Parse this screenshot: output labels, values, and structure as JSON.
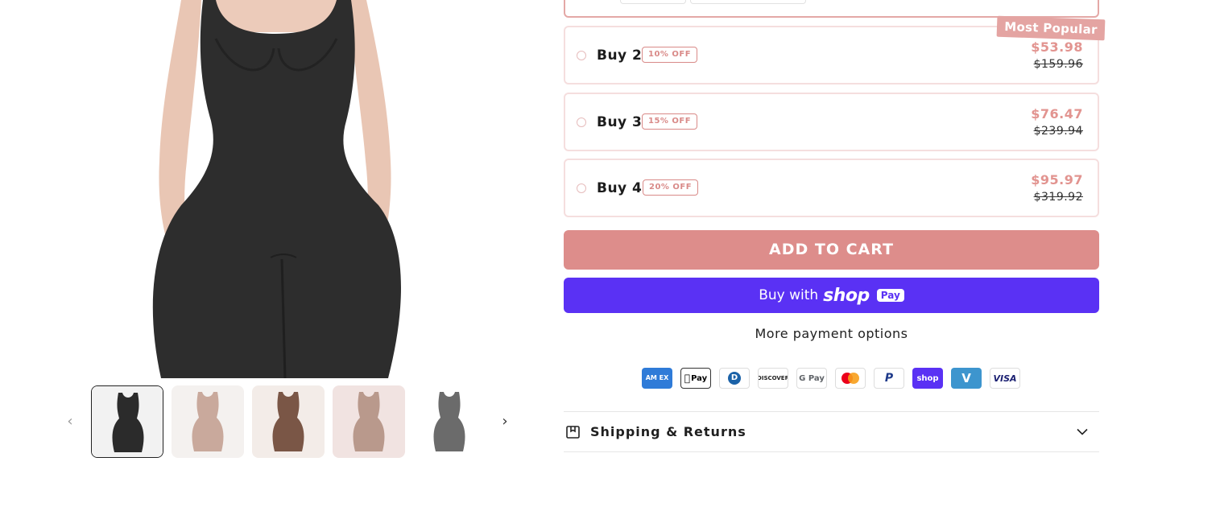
{
  "gallery": {
    "main_image_alt": "Black seamless bodysuit shapewear",
    "prev_icon": "chevron-left-icon",
    "next_icon": "chevron-right-icon",
    "thumbnails": [
      {
        "color": "#2b2b2b",
        "bg": "#f2f2f2",
        "active": true
      },
      {
        "color": "#c9a99c",
        "bg": "#f4f1ef",
        "active": false
      },
      {
        "color": "#7a5646",
        "bg": "#f3ece8",
        "active": false
      },
      {
        "color": "#b9998c",
        "bg": "#f1e3e1",
        "active": false
      },
      {
        "color": "#6b6b6b",
        "bg": "#ffffff",
        "active": false
      }
    ]
  },
  "bundle": {
    "ribbon": "Most Popular",
    "options": [
      {
        "name": "Buy 2",
        "badge": "10% OFF",
        "price": "$53.98",
        "compare": "$159.96"
      },
      {
        "name": "Buy 3",
        "badge": "15% OFF",
        "price": "$76.47",
        "compare": "$239.94"
      },
      {
        "name": "Buy 4",
        "badge": "20% OFF",
        "price": "$95.97",
        "compare": "$319.92"
      }
    ]
  },
  "actions": {
    "add_to_cart": "ADD TO CART",
    "buy_with": "Buy with",
    "shop_pay_logo": "shop",
    "shop_pay_pill": "Pay",
    "more_options": "More payment options"
  },
  "payment_methods": [
    {
      "name": "american-express-icon",
      "label": "AM EX"
    },
    {
      "name": "apple-pay-icon",
      "label": "Pay"
    },
    {
      "name": "diners-club-icon",
      "label": "D"
    },
    {
      "name": "discover-icon",
      "label": "DISCOVER"
    },
    {
      "name": "google-pay-icon",
      "label": "G Pay"
    },
    {
      "name": "mastercard-icon",
      "label": ""
    },
    {
      "name": "paypal-icon",
      "label": "P"
    },
    {
      "name": "shop-pay-icon",
      "label": "shop"
    },
    {
      "name": "venmo-icon",
      "label": "V"
    },
    {
      "name": "visa-icon",
      "label": "VISA"
    }
  ],
  "accordion": {
    "shipping_title": "Shipping & Returns"
  },
  "colors": {
    "accent": "#dd8d8b",
    "shop_pay": "#5a31f4",
    "option_border": "#f5dede"
  }
}
